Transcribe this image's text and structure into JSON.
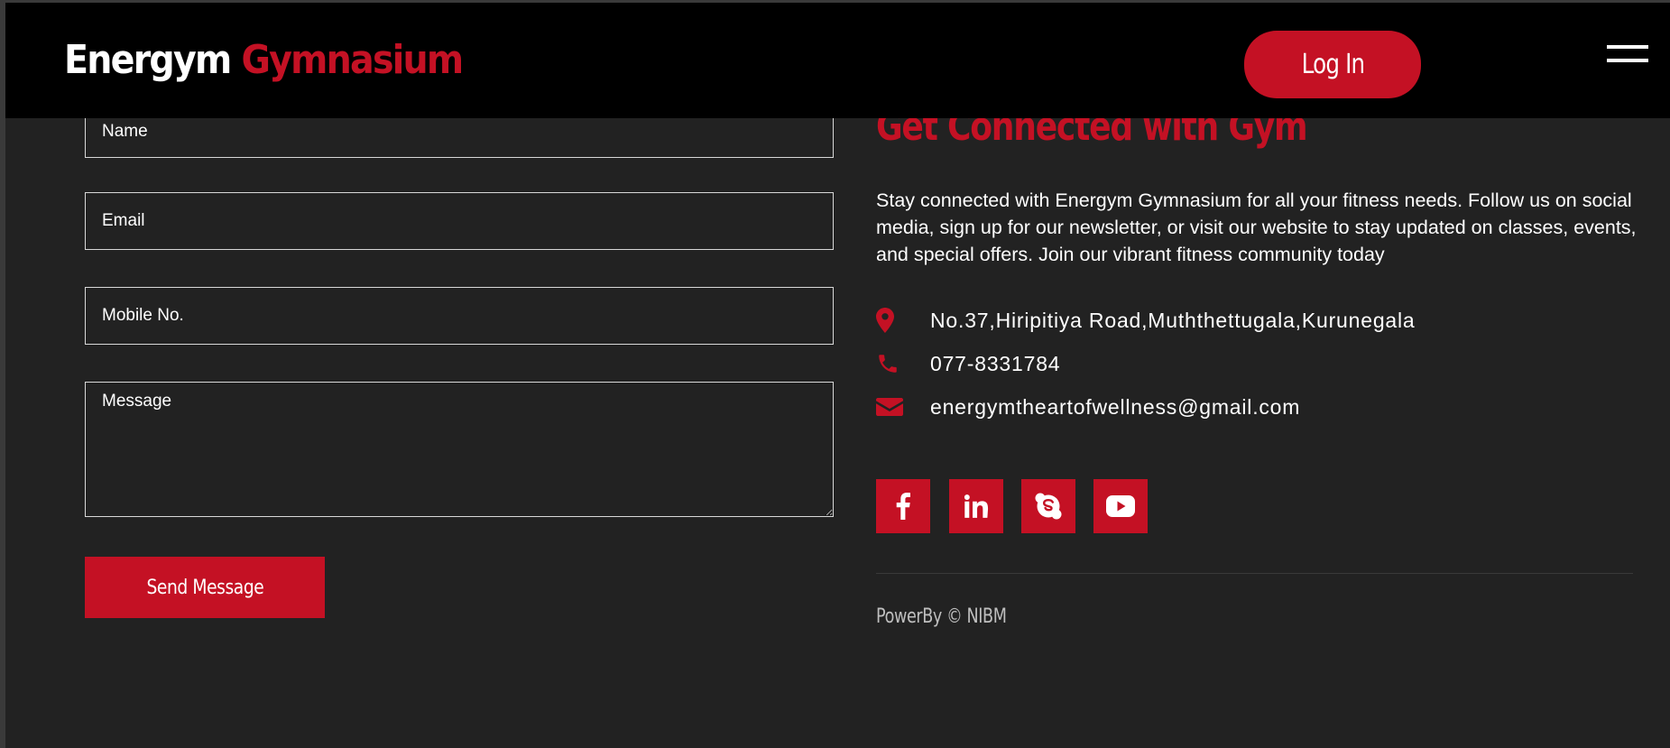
{
  "header": {
    "brand_part1": "Energym",
    "brand_part2": "Gymnasium",
    "login_label": "Log In",
    "menu_icon": "hamburger-menu-icon"
  },
  "form": {
    "name_placeholder": "Name",
    "email_placeholder": "Email",
    "mobile_placeholder": "Mobile No.",
    "message_placeholder": "Message",
    "submit_label": "Send Message"
  },
  "contact": {
    "heading": "Get Connected with Gym",
    "intro": "Stay connected with Energym Gymnasium for all your fitness needs. Follow us on social media, sign up for our newsletter, or visit our website to stay updated on classes, events, and special offers. Join our vibrant fitness community today",
    "address": "No.37,Hiripitiya Road,Muththettugala,Kurunegala",
    "phone": "077-8331784",
    "email": "energymtheartofwellness@gmail.com",
    "icons": [
      "map-pin-icon",
      "phone-icon",
      "envelope-icon"
    ]
  },
  "social": {
    "icons": [
      "facebook-icon",
      "linkedin-icon",
      "skype-icon",
      "youtube-icon"
    ]
  },
  "footer": {
    "text": "PowerBy © NIBM"
  },
  "colors": {
    "accent": "#c41124",
    "header_bg": "#000000",
    "page_bg": "#222222",
    "text": "#ffffff"
  }
}
